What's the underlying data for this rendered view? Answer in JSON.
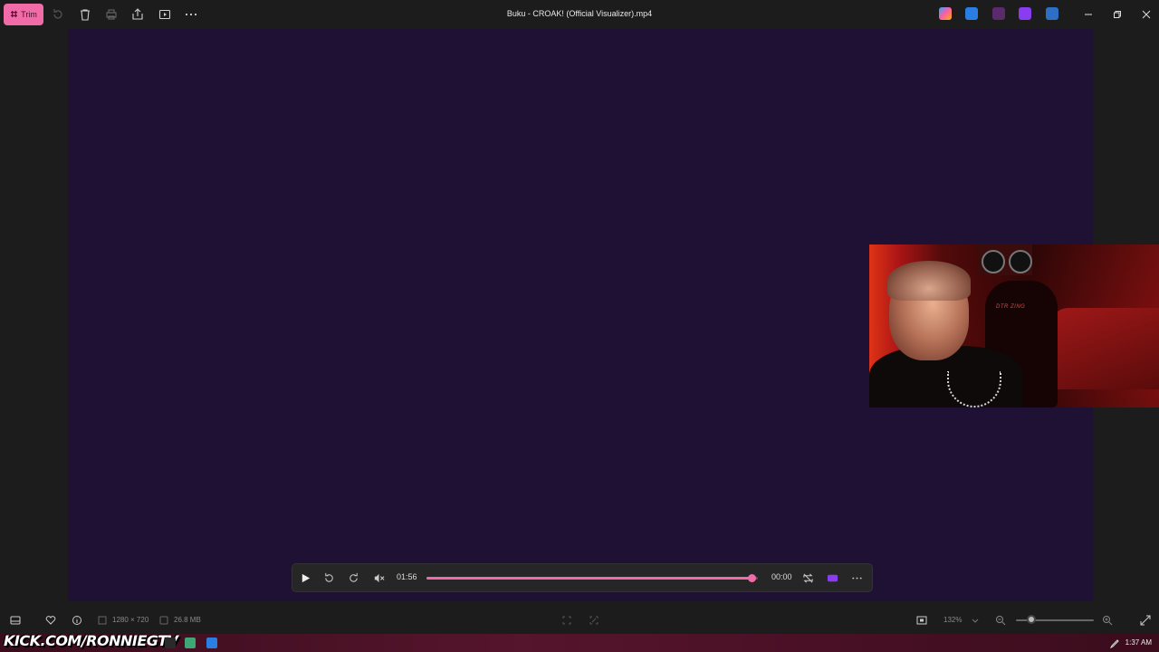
{
  "titlebar": {
    "trim_label": "Trim",
    "title": "Buku - CROAK! (Official Visualizer).mp4",
    "icons": [
      "trim-icon",
      "rotate-icon",
      "delete-icon",
      "print-icon",
      "share-icon",
      "slideshow-icon",
      "more-icon"
    ],
    "window_controls": [
      "minimize-icon",
      "restore-icon",
      "close-icon"
    ]
  },
  "player": {
    "elapsed": "01:56",
    "remaining": "00:00",
    "progress_fraction": 0.98,
    "accent_color": "#f06ba8"
  },
  "statusbar": {
    "dimensions": "1280 × 720",
    "file_size": "26.8 MB",
    "zoom": "132%",
    "zoom_slider_fraction": 0.2
  },
  "overlay": {
    "text": "KICK.COM/RONNIEGTV"
  },
  "webcam": {
    "chair_text": "DTR ZING"
  },
  "taskbar": {
    "time": "1:37 AM"
  },
  "colors": {
    "background": "#1c1c1c",
    "video": "#1f1133",
    "accent": "#f06ba8"
  }
}
